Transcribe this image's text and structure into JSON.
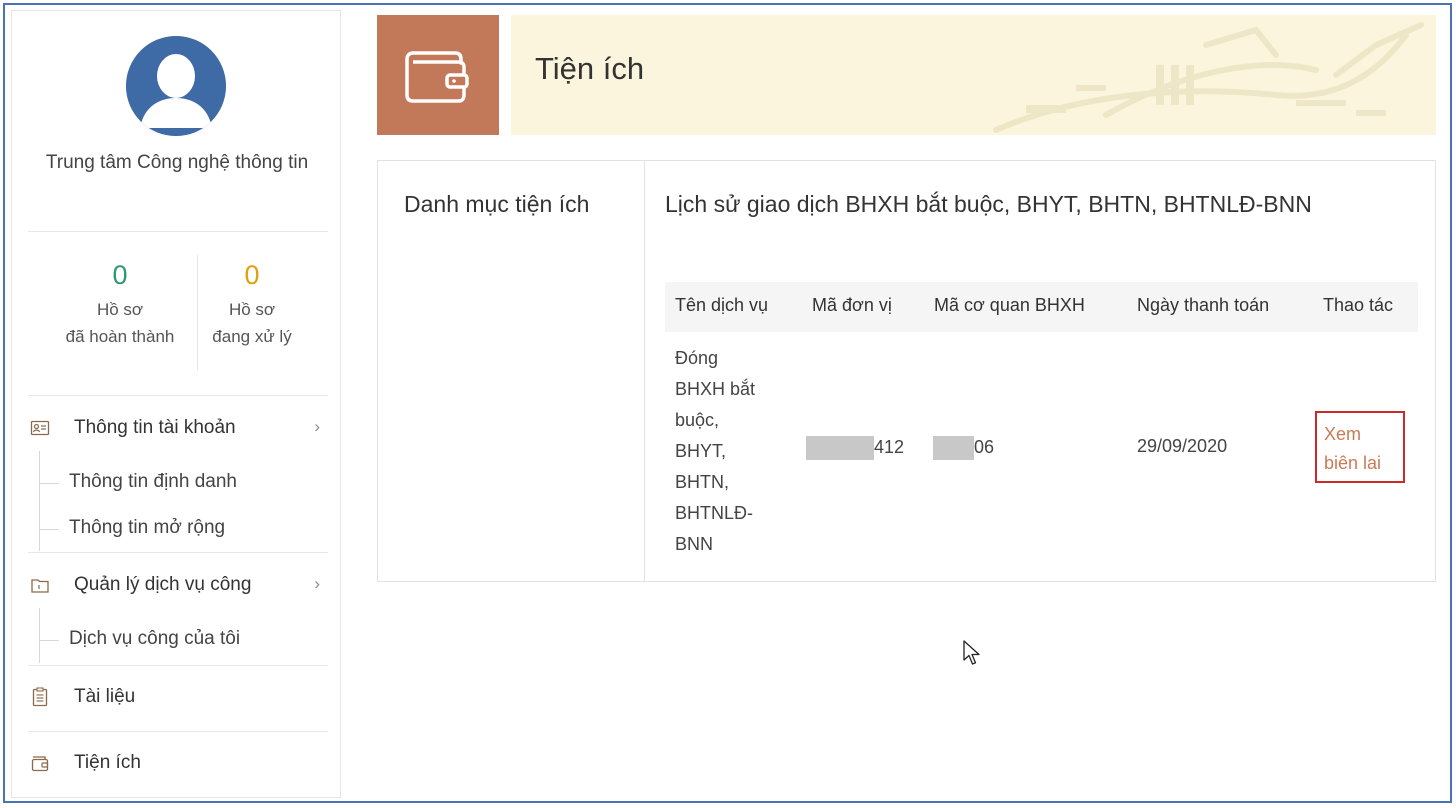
{
  "sidebar": {
    "org_name": "Trung tâm Công nghệ thông tin",
    "stats": [
      {
        "count": "0",
        "label_line1": "Hồ sơ",
        "label_line2": "đã hoàn thành",
        "color": "#2b9a6e"
      },
      {
        "count": "0",
        "label_line1": "Hồ sơ",
        "label_line2": "đang xử lý",
        "color": "#e0a10f"
      }
    ],
    "menu": {
      "account": {
        "label": "Thông tin tài khoản",
        "icon": "id-card-icon",
        "sub": [
          "Thông tin định danh",
          "Thông tin mở rộng"
        ]
      },
      "services": {
        "label": "Quản lý dịch vụ công",
        "icon": "folder-icon",
        "sub": [
          "Dịch vụ công của tôi"
        ]
      },
      "documents": {
        "label": "Tài liệu",
        "icon": "document-icon"
      },
      "utilities": {
        "label": "Tiện ích",
        "icon": "wallet-icon"
      }
    }
  },
  "header": {
    "title": "Tiện ích",
    "icon": "wallet-icon",
    "accent": "#c2795a",
    "banner_bg": "#faf5dc"
  },
  "content": {
    "category_title": "Danh mục tiện ích",
    "section_title": "Lịch sử giao dịch BHXH bắt buộc, BHYT, BHTN, BHTNLĐ-BNN",
    "table": {
      "columns": [
        "Tên dịch vụ",
        "Mã đơn vị",
        "Mã cơ quan BHXH",
        "Ngày thanh toán",
        "Thao tác"
      ],
      "rows": [
        {
          "service_name_lines": [
            "Đóng",
            "BHXH bắt",
            "buộc,",
            "BHYT,",
            "BHTN,",
            "BHTNLĐ-",
            "BNN"
          ],
          "unit_code_suffix": "412",
          "agency_code_suffix": "06",
          "payment_date": "29/09/2020",
          "action_lines": [
            "Xem",
            "biên lai"
          ]
        }
      ]
    }
  }
}
